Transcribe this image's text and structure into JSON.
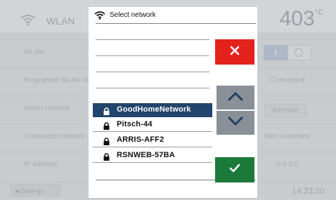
{
  "background": {
    "title": "WLAN",
    "temperature": "403",
    "temperature_unit": "°C",
    "rows": [
      {
        "label": "WLAN",
        "value": ""
      },
      {
        "label": "Programed WLAN slo",
        "value": "Connected"
      },
      {
        "label": "Select network",
        "value": "Execute"
      },
      {
        "label": "Connected network",
        "value": "Not connected"
      },
      {
        "label": "IP address",
        "value": "0.0.0.0"
      }
    ],
    "toggle_on_label": "I",
    "back_label": "Settings",
    "clock": "14:23:20"
  },
  "dialog": {
    "title": "Select network",
    "networks": [
      {
        "name": "GoodHomeNetwork",
        "locked": true,
        "selected": true
      },
      {
        "name": "Pitsch-44",
        "locked": true,
        "selected": false
      },
      {
        "name": "ARRIS-AFF2",
        "locked": true,
        "selected": false
      },
      {
        "name": "RSNWEB-57BA",
        "locked": true,
        "selected": false
      }
    ],
    "icons": {
      "wifi": "wifi-icon",
      "lock": "lock-icon",
      "cancel": "close-icon",
      "up": "chevron-up-icon",
      "down": "chevron-down-icon",
      "confirm": "check-icon"
    },
    "colors": {
      "selected_row": "#23446c",
      "cancel": "#e3221c",
      "confirm": "#1b7a3a",
      "scroll": "#8a9097"
    }
  }
}
